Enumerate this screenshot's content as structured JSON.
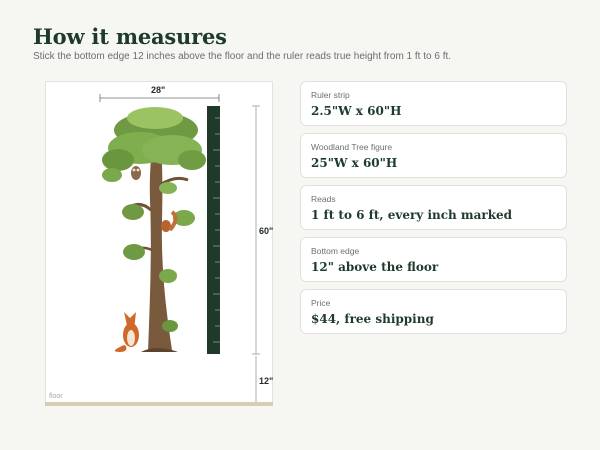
{
  "header": {
    "title": "How it measures",
    "subtitle": "Stick the bottom edge 12 inches above the floor and the ruler reads true height from 1 ft to 6 ft."
  },
  "diagram": {
    "width_label": "28\"",
    "height_label": "60\"",
    "offset_label": "12\"",
    "floor_label": "floor"
  },
  "specs": [
    {
      "label": "Ruler strip",
      "value": "2.5\"W x 60\"H"
    },
    {
      "label": "Woodland Tree figure",
      "value": "25\"W x 60\"H"
    },
    {
      "label": "Reads",
      "value": "1 ft to 6 ft, every inch marked"
    },
    {
      "label": "Bottom edge",
      "value": "12\" above the floor"
    },
    {
      "label": "Price",
      "value": "$44, free shipping"
    }
  ],
  "colors": {
    "accent": "#1d3a2a",
    "ruler": "#1f3a2b",
    "floor": "#d8ccb5"
  }
}
